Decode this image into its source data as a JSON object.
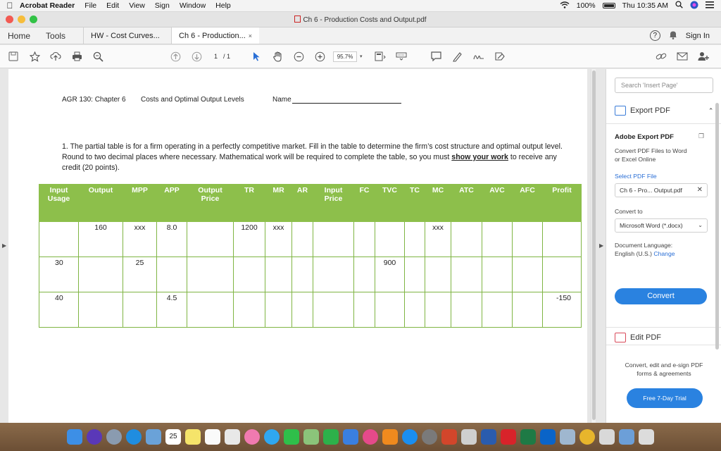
{
  "menubar": {
    "app": "Acrobat Reader",
    "items": [
      "File",
      "Edit",
      "View",
      "Sign",
      "Window",
      "Help"
    ],
    "battery": "100%",
    "clock": "Thu 10:35 AM"
  },
  "window": {
    "title": "Ch 6 - Production Costs and Output.pdf"
  },
  "tabbar": {
    "home": "Home",
    "tools": "Tools",
    "tabs": [
      {
        "label": "HW - Cost Curves..."
      },
      {
        "label": "Ch 6 - Production...",
        "close": "×"
      }
    ],
    "help": "?",
    "sign_in": "Sign In"
  },
  "toolbar": {
    "page_current": "1",
    "page_total": "/ 1",
    "zoom": "95.7%",
    "icons": [
      "save-icon",
      "star-icon",
      "upload-icon",
      "print-icon",
      "zoom-search-icon",
      "page-up-icon",
      "page-down-icon",
      "select-arrow-icon",
      "hand-icon",
      "zoom-out-icon",
      "zoom-in-icon",
      "fit-page-icon",
      "keyboard-icon",
      "comment-icon",
      "highlight-icon",
      "sign-icon",
      "fill-sign-icon",
      "link-share-icon",
      "mail-icon",
      "add-user-icon"
    ]
  },
  "document": {
    "course": "AGR 130: Chapter 6",
    "topic": "Costs and Optimal Output Levels",
    "name_label": "Name",
    "question": {
      "part1": "1. The partial table is for a firm operating in a perfectly competitive market.  Fill in the table to determine the firm’s cost structure and optimal output level.   Round to two decimal places where necessary. Mathematical work will be required to complete the table, so you must ",
      "emphasis": "show your work",
      "part2": " to receive any credit (20 points)."
    },
    "table": {
      "headers": [
        [
          "Input",
          "Usage"
        ],
        [
          "Output",
          ""
        ],
        [
          "MPP",
          ""
        ],
        [
          "APP",
          ""
        ],
        [
          "Output",
          "Price"
        ],
        [
          "TR",
          ""
        ],
        [
          "MR",
          ""
        ],
        [
          "AR",
          ""
        ],
        [
          "Input",
          "Price"
        ],
        [
          "FC",
          ""
        ],
        [
          "TVC",
          ""
        ],
        [
          "TC",
          ""
        ],
        [
          "MC",
          ""
        ],
        [
          "ATC",
          ""
        ],
        [
          "AVC",
          ""
        ],
        [
          "AFC",
          ""
        ],
        [
          "Profit",
          ""
        ]
      ],
      "rows": [
        [
          "",
          "160",
          "xxx",
          "8.0",
          "",
          "1200",
          "xxx",
          "",
          "",
          "",
          "",
          "",
          "xxx",
          "",
          "",
          "",
          ""
        ],
        [
          "30",
          "",
          "25",
          "",
          "",
          "",
          "",
          "",
          "",
          "",
          "900",
          "",
          "",
          "",
          "",
          "",
          ""
        ],
        [
          "40",
          "",
          "",
          "4.5",
          "",
          "",
          "",
          "",
          "",
          "",
          "",
          "",
          "",
          "",
          "",
          "",
          "-150"
        ]
      ]
    }
  },
  "right_pane": {
    "search_placeholder": "Search 'Insert Page'",
    "export_pdf": "Export PDF",
    "adobe_export_title": "Adobe Export PDF",
    "adobe_export_desc1": "Convert PDF Files to Word",
    "adobe_export_desc2": "or Excel Online",
    "select_pdf_file": "Select PDF File",
    "selected_file": "Ch 6 - Pro... Output.pdf",
    "convert_to_label": "Convert to",
    "convert_to_value": "Microsoft Word (*.docx)",
    "document_language_label": "Document Language:",
    "document_language_value": "English (U.S.)",
    "change_link": "Change",
    "convert_button": "Convert",
    "edit_pdf": "Edit PDF",
    "promo_line1": "Convert, edit and e-sign PDF",
    "promo_line2": "forms & agreements",
    "trial_button": "Free 7-Day Trial"
  },
  "dock": {
    "calendar_day": "25",
    "apps": [
      "finder-icon",
      "siri-icon",
      "launchpad-icon",
      "safari-icon",
      "photos-icon",
      "calendar-icon",
      "notes-icon",
      "reminders-icon",
      "photos-wheel-icon",
      "messages-icon",
      "facetime-icon",
      "maps-icon",
      "numbers-icon",
      "keynote-icon",
      "itunes-icon",
      "books-icon",
      "app-store-icon",
      "system-preferences-icon",
      "powerpoint-icon",
      "trackpad-icon",
      "word-icon",
      "acrobat-icon",
      "excel-icon",
      "outlook-icon",
      "preview-icon",
      "chrome-icon",
      "downloads-icon",
      "folder-icon",
      "trash-icon"
    ]
  }
}
